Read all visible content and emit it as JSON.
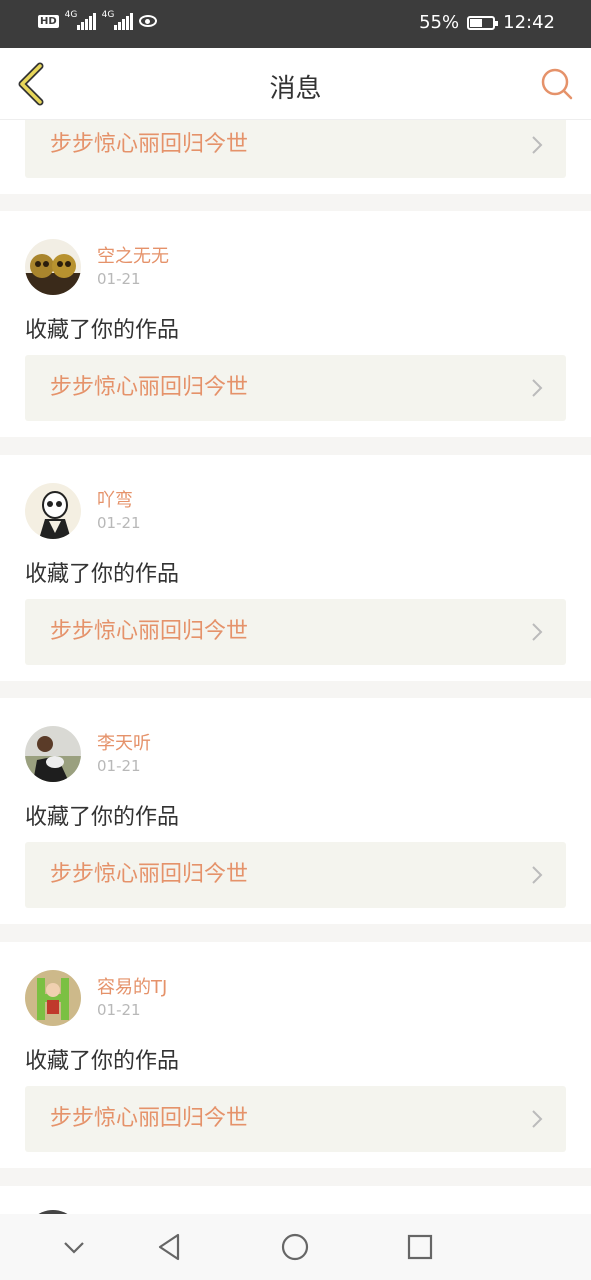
{
  "status_bar": {
    "network1": "4G",
    "network2": "4G",
    "hd": "HD",
    "battery_pct": "55%",
    "battery_level": 0.55,
    "time": "12:42"
  },
  "header": {
    "title": "消息",
    "back_icon": "chevron-left-icon",
    "search_icon": "search-icon"
  },
  "first_work": {
    "title": "步步惊心丽回归今世"
  },
  "notifications": [
    {
      "user": "空之无无",
      "date": "01-21",
      "action": "收藏了你的作品",
      "work": "步步惊心丽回归今世"
    },
    {
      "user": "吖弯",
      "date": "01-21",
      "action": "收藏了你的作品",
      "work": "步步惊心丽回归今世"
    },
    {
      "user": "李天听",
      "date": "01-21",
      "action": "收藏了你的作品",
      "work": "步步惊心丽回归今世"
    },
    {
      "user": "容易的TJ",
      "date": "01-21",
      "action": "收藏了你的作品",
      "work": "步步惊心丽回归今世"
    }
  ],
  "colors": {
    "accent": "#e5926a",
    "back_arrow": "#e8d75a",
    "status_bg": "#3c3c3c"
  },
  "nav": {
    "icons": [
      "chevron-down-icon",
      "back-triangle-icon",
      "home-circle-icon",
      "recents-square-icon"
    ]
  }
}
